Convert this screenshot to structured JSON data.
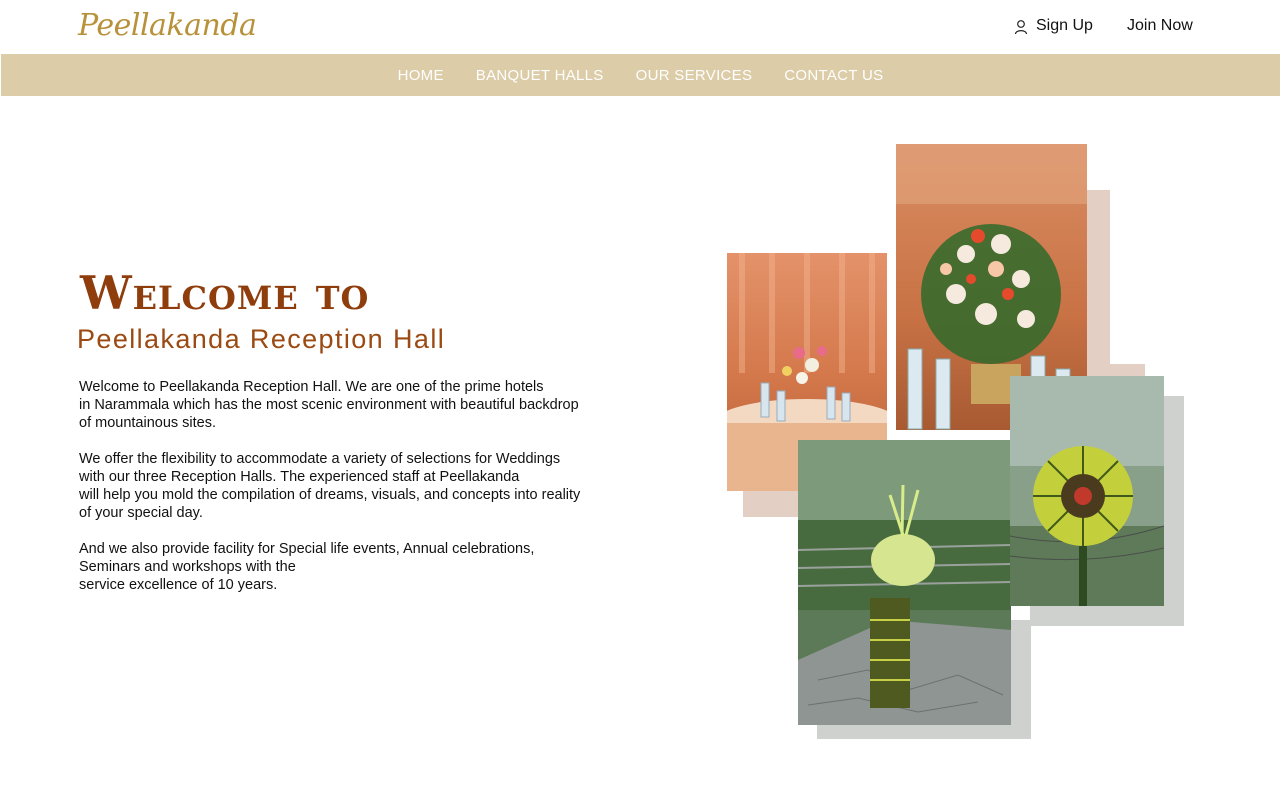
{
  "header": {
    "logo": "Peellakanda",
    "signup_label": "Sign Up",
    "join_label": "Join Now",
    "icons": {
      "user": "user-icon"
    }
  },
  "nav": {
    "items": [
      {
        "label": "HOME"
      },
      {
        "label": "BANQUET HALLS"
      },
      {
        "label": "OUR SERVICES"
      },
      {
        "label": "CONTACT US"
      }
    ]
  },
  "hero": {
    "welcome": "Welcome to",
    "subtitle": "Peellakanda Reception Hall",
    "paragraphs": [
      {
        "lines": [
          "Welcome to Peellakanda Reception Hall. We are one of the prime hotels",
          "in Narammala which has the most scenic environment with beautiful backdrop",
          "of mountainous sites."
        ]
      },
      {
        "lines": [
          "We offer the flexibility to accommodate a variety of selections for Weddings",
          "with our three Reception Halls. The experienced staff at Peellakanda",
          "will help you mold the compilation of dreams, visuals, and concepts into reality",
          "of your special day."
        ]
      },
      {
        "lines": [
          "And we also provide facility for Special life events, Annual celebrations,",
          "Seminars and workshops with the",
          "service excellence of 10 years."
        ]
      }
    ]
  },
  "colors": {
    "logo": "#b8923a",
    "nav_bg": "#dccca7",
    "heading": "#8f3d0c",
    "shadow_warm": "#e3cfc3",
    "shadow_grey": "#cfd1cf"
  }
}
